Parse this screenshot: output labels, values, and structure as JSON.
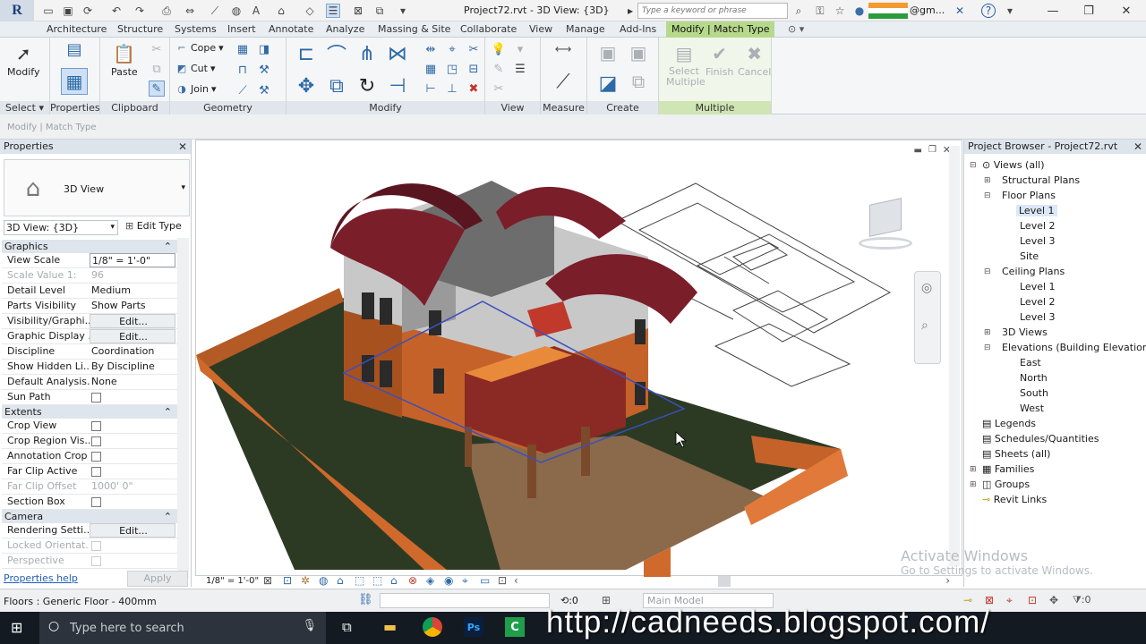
{
  "titlebar": {
    "app_logo": "R",
    "doc_title": "Project72.rvt - 3D View: {3D}",
    "search_placeholder": "Type a keyword or phrase",
    "user_label": "@gm...",
    "help_label": "?",
    "minimize": "—",
    "restore": "❐",
    "close": "✕"
  },
  "ribbon_tabs": [
    "Architecture",
    "Structure",
    "Systems",
    "Insert",
    "Annotate",
    "Analyze",
    "Massing & Site",
    "Collaborate",
    "View",
    "Manage",
    "Add-Ins",
    "Modify | Match Type"
  ],
  "ribbon": {
    "modify_label": "Modify",
    "select_label": "Select ▾",
    "properties_label": "Properties",
    "paste_label": "Paste",
    "clipboard_label": "Clipboard",
    "cope_label": "Cope",
    "cut_label": "Cut",
    "join_label": "Join",
    "geometry_label": "Geometry",
    "modify_panel_label": "Modify",
    "view_label": "View",
    "measure_label": "Measure",
    "create_label": "Create",
    "select_multiple_label": "Select Multiple",
    "finish_label": "Finish",
    "cancel_label": "Cancel",
    "multiple_label": "Multiple"
  },
  "options_bar": {
    "context": "Modify | Match Type"
  },
  "properties": {
    "title": "Properties",
    "type_name": "3D View",
    "instance": "3D View: {3D}",
    "edit_type": "Edit Type",
    "groups": {
      "graphics": "Graphics",
      "extents": "Extents",
      "camera": "Camera"
    },
    "rows": [
      {
        "k": "View Scale",
        "v": "1/8\" = 1'-0\""
      },
      {
        "k": "Scale Value 1:",
        "v": "96"
      },
      {
        "k": "Detail Level",
        "v": "Medium"
      },
      {
        "k": "Parts Visibility",
        "v": "Show Parts"
      },
      {
        "k": "Visibility/Graphi...",
        "v": "Edit..."
      },
      {
        "k": "Graphic Display ...",
        "v": "Edit..."
      },
      {
        "k": "Discipline",
        "v": "Coordination"
      },
      {
        "k": "Show Hidden Li...",
        "v": "By Discipline"
      },
      {
        "k": "Default Analysis...",
        "v": "None"
      },
      {
        "k": "Sun Path",
        "v": ""
      },
      {
        "k": "Crop View",
        "v": ""
      },
      {
        "k": "Crop Region Vis...",
        "v": ""
      },
      {
        "k": "Annotation Crop",
        "v": ""
      },
      {
        "k": "Far Clip Active",
        "v": ""
      },
      {
        "k": "Far Clip Offset",
        "v": "1000' 0\""
      },
      {
        "k": "Section Box",
        "v": ""
      },
      {
        "k": "Rendering Setti...",
        "v": "Edit..."
      },
      {
        "k": "Locked Orientat...",
        "v": ""
      },
      {
        "k": "Perspective",
        "v": ""
      }
    ],
    "help_link": "Properties help",
    "apply": "Apply"
  },
  "viewport": {
    "scale": "1/8\" = 1'-0\""
  },
  "browser": {
    "title": "Project Browser - Project72.rvt",
    "nodes": [
      "Views (all)",
      "Structural Plans",
      "Floor Plans",
      "Level 1",
      "Level 2",
      "Level 3",
      "Site",
      "Ceiling Plans",
      "Level 1",
      "Level 2",
      "Level 3",
      "3D Views",
      "Elevations (Building Elevation)",
      "East",
      "North",
      "South",
      "West",
      "Legends",
      "Schedules/Quantities",
      "Sheets (all)",
      "Families",
      "Groups",
      "Revit Links"
    ]
  },
  "status": {
    "text": "Floors : Generic Floor - 400mm",
    "zero_a": ":0",
    "main_model": "Main Model",
    "zero_b": ":0"
  },
  "activation": {
    "line1": "Activate Windows",
    "line2": "Go to Settings to activate Windows."
  },
  "taskbar": {
    "search": "Type here to search",
    "watermark": "http://cadneeds.blogspot.com/"
  },
  "colors": {
    "ribbon_active_tab": "#b6d98c",
    "roof": "#7a1e2a",
    "brick": "#c4622a",
    "lawn": "#2c3a24",
    "slab": "#b3703a"
  }
}
